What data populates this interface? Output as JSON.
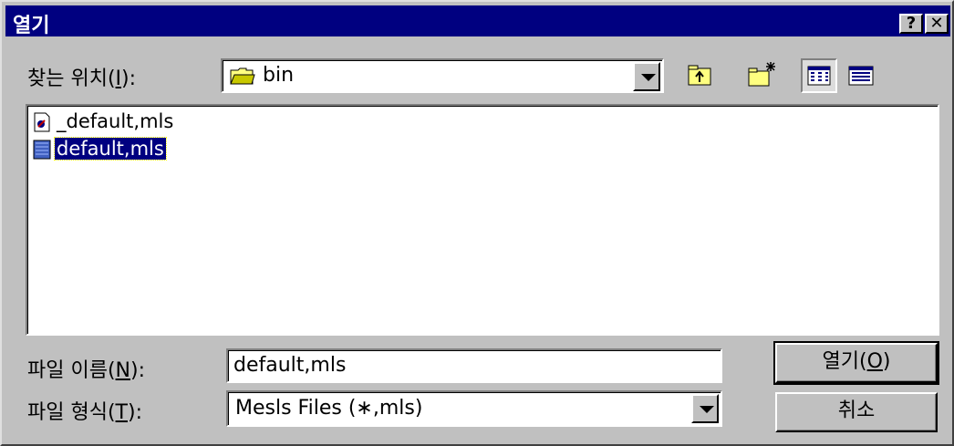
{
  "window": {
    "title": "열기"
  },
  "titlebar": {
    "help_label": "?",
    "close_label": "✕"
  },
  "lookin": {
    "label_pre": "찾는 위치(",
    "label_key": "I",
    "label_post": "):",
    "value": "bin"
  },
  "files": [
    {
      "name": "_default,mls",
      "selected": false
    },
    {
      "name": "default,mls",
      "selected": true
    }
  ],
  "filename": {
    "label_pre": "파일 이름(",
    "label_key": "N",
    "label_post": "):",
    "value": "default,mls"
  },
  "filetype": {
    "label_pre": "파일 형식(",
    "label_key": "T",
    "label_post": "):",
    "value": "Mesls Files (∗,mls)"
  },
  "buttons": {
    "open_pre": "열기(",
    "open_key": "O",
    "open_post": ")",
    "cancel": "취소"
  }
}
